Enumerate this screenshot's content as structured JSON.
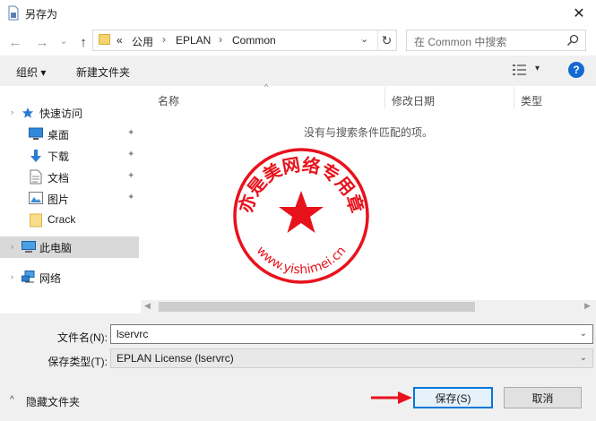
{
  "window": {
    "title": "另存为",
    "close_glyph": "✕"
  },
  "nav": {
    "back_glyph": "←",
    "forward_glyph": "→",
    "recent_glyph": "⌄",
    "up_glyph": "↑",
    "breadcrumb": [
      "«",
      "公用",
      "EPLAN",
      "Common"
    ],
    "crumb_separator": "›",
    "dropdown_glyph": "⌄",
    "refresh_glyph": "↻",
    "search_placeholder": "在 Common 中搜索"
  },
  "toolbar": {
    "organize_label": "组织 ▾",
    "new_folder_label": "新建文件夹",
    "view_dropdown_glyph": "▾",
    "help_glyph": "?"
  },
  "sidebar": {
    "quick_access": "快速访问",
    "items": [
      {
        "label": "桌面",
        "icon": "desktop-icon",
        "pinned": true
      },
      {
        "label": "下载",
        "icon": "download-icon",
        "pinned": true
      },
      {
        "label": "文档",
        "icon": "document-icon",
        "pinned": true
      },
      {
        "label": "图片",
        "icon": "pictures-icon",
        "pinned": true
      },
      {
        "label": "Crack",
        "icon": "folder-icon",
        "pinned": false
      }
    ],
    "this_pc": "此电脑",
    "network": "网络",
    "pin_glyph": "✦"
  },
  "file_list": {
    "columns": [
      "名称",
      "修改日期",
      "类型"
    ],
    "sort_glyph": "^",
    "empty_message": "没有与搜索条件匹配的项。"
  },
  "form": {
    "filename_label": "文件名(N):",
    "filename_value": "lservrc",
    "filetype_label": "保存类型(T):",
    "filetype_value": "EPLAN License (lservrc)",
    "dropdown_glyph": "⌄"
  },
  "footer": {
    "hide_folders_label": "隐藏文件夹",
    "hide_glyph": "^",
    "save_label": "保存(S)",
    "cancel_label": "取消"
  },
  "watermark": {
    "top_text": "亦是美网络专用章",
    "bottom_text": "www.yishimei.cn",
    "color": "#e8121c"
  },
  "colors": {
    "accent": "#0078d7",
    "help": "#1769d2",
    "folder": "#f5d36f",
    "selection": "#d9d9d9"
  }
}
